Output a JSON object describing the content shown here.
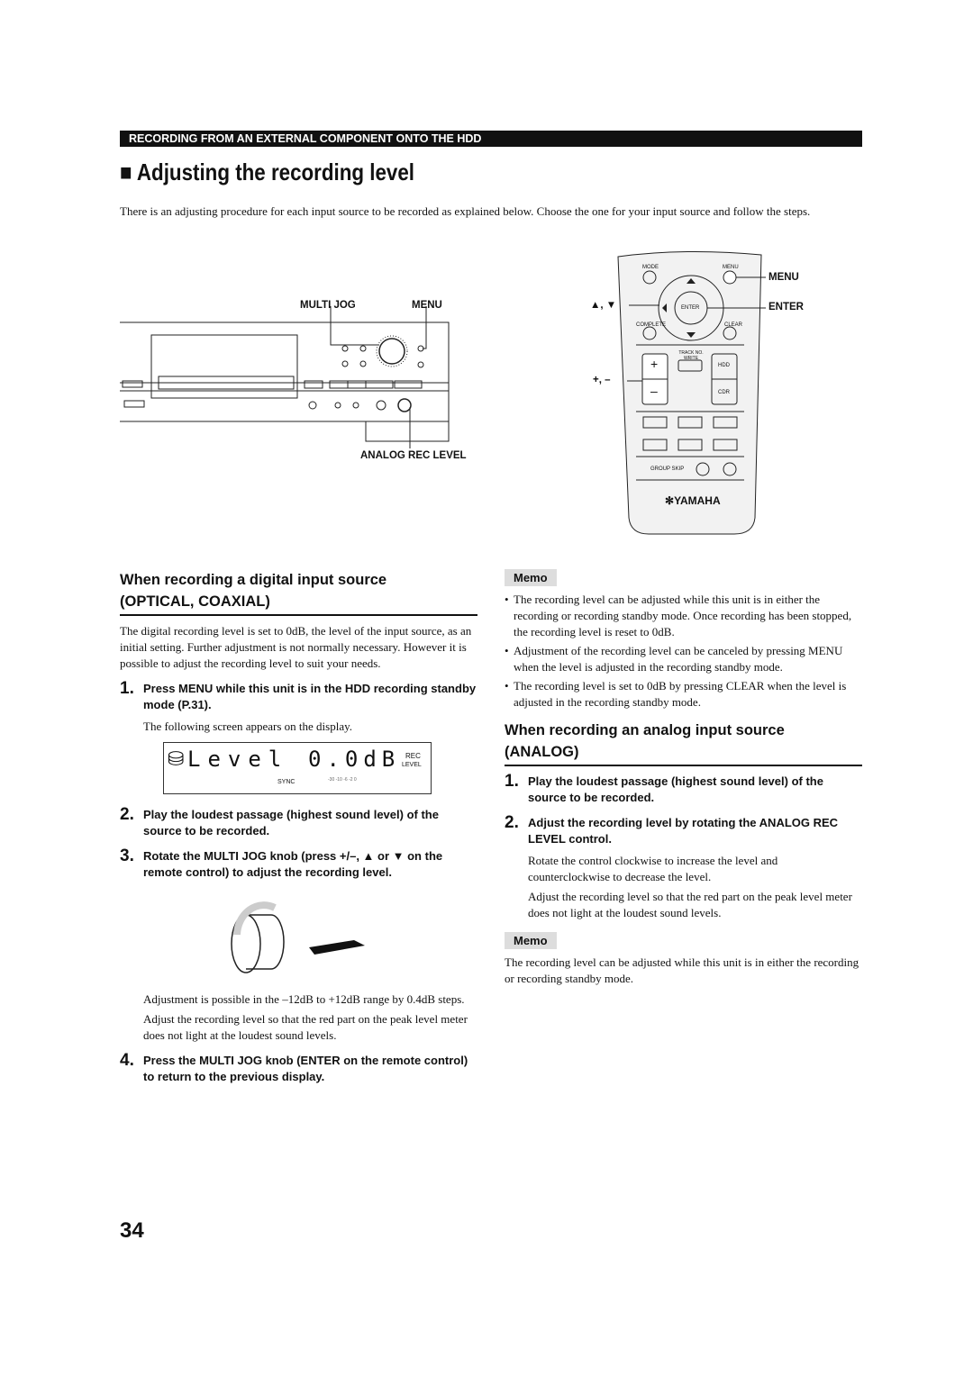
{
  "header_bar": "RECORDING FROM AN EXTERNAL COMPONENT ONTO THE HDD",
  "title_icon": "black-square",
  "title": "Adjusting the recording level",
  "intro": "There is an adjusting procedure for each input source to be recorded as explained below. Choose the one for your input source and follow the steps.",
  "front_panel": {
    "labels": {
      "multi_jog": "MULTI JOG",
      "menu": "MENU",
      "analog_rec_level": "ANALOG REC LEVEL"
    }
  },
  "remote": {
    "labels": {
      "menu": "MENU",
      "enter": "ENTER",
      "up_down": "▲, ▼",
      "plus_minus": "+, –"
    },
    "buttons": {
      "mode": "MODE",
      "menu": "MENU",
      "enter": "ENTER",
      "complete": "COMPLETE",
      "clear": "CLEAR",
      "track_no_write": "TRACK NO. WRITE",
      "hdd": "HDD",
      "cdr": "CDR",
      "group_skip": "GROUP SKIP",
      "plus": "+",
      "minus": "–"
    },
    "brand": "YAMAHA"
  },
  "left": {
    "heading_line1": "When recording a digital input source",
    "heading_line2": "(OPTICAL, COAXIAL)",
    "body": "The digital recording level is set to 0dB, the level of the input source, as an initial setting. Further adjustment is not normally necessary. However it is possible to adjust the recording level to suit your needs.",
    "steps": [
      {
        "n": "1.",
        "text": "Press MENU while this unit is in the HDD recording standby mode (P.31).",
        "sub": [
          "The following screen appears on the display."
        ]
      },
      {
        "n": "2.",
        "text": "Play the loudest passage (highest sound level) of the source to be recorded."
      },
      {
        "n": "3.",
        "text": "Rotate the MULTI JOG knob (press +/–, ▲ or ▼ on the remote control) to adjust the recording level.",
        "sub": [
          "Adjustment is possible in the –12dB to +12dB range by 0.4dB steps.",
          "Adjust the recording level so that the red part on the peak level meter does not light at the loudest sound levels."
        ]
      },
      {
        "n": "4.",
        "text": "Press the MULTI JOG knob (ENTER on the remote control) to return to the previous display."
      }
    ],
    "display": {
      "text": "Level",
      "value": "0.0dB",
      "rec": "REC",
      "level": "LEVEL",
      "sync": "SYNC",
      "meter": "-30 -10 -6 -2 0"
    }
  },
  "right": {
    "memo_label": "Memo",
    "memo_items": [
      "The recording level can be adjusted while this unit is in either the recording or recording standby mode. Once recording has been stopped, the recording level is reset to 0dB.",
      "Adjustment of the recording level can be canceled by pressing MENU when the level is adjusted in the recording standby mode.",
      "The recording level is set to 0dB by pressing CLEAR when the level is adjusted in the recording standby mode."
    ],
    "heading_line1": "When recording an analog input source",
    "heading_line2": "(ANALOG)",
    "steps": [
      {
        "n": "1.",
        "text": "Play the loudest passage (highest sound level) of the source to be recorded."
      },
      {
        "n": "2.",
        "text": "Adjust the recording level by rotating the ANALOG REC LEVEL control.",
        "sub": [
          "Rotate the control clockwise to increase the level and counterclockwise to decrease the level.",
          "Adjust the recording level so that the red part on the peak level meter does not light at the loudest sound levels."
        ]
      }
    ],
    "memo2_label": "Memo",
    "memo2_text": "The recording level can be adjusted while this unit is in either the recording or recording standby mode."
  },
  "page_number": "34"
}
